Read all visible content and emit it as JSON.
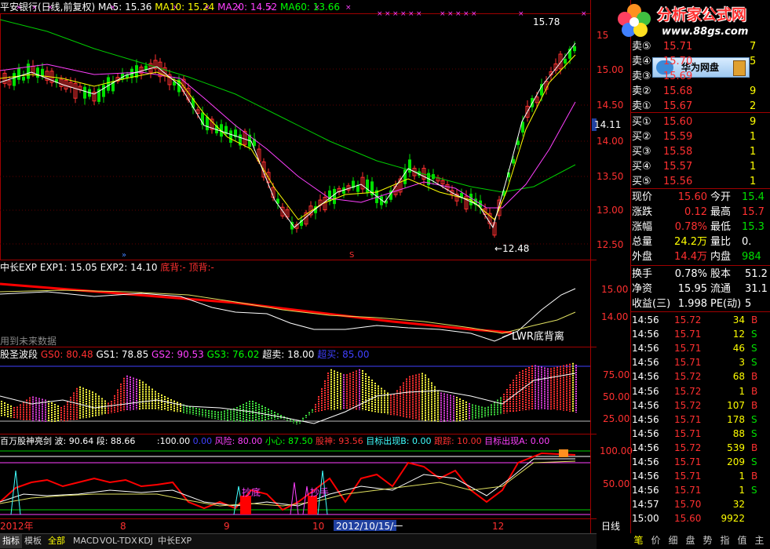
{
  "header": {
    "stock_title": "平安银行(日线,前复权)",
    "ma5": "MA5: 15.36",
    "ma10": "MA10: 15.24",
    "ma20": "MA20: 14.52",
    "ma60": "MA60: 13.66"
  },
  "price_axis": [
    "15.00",
    "14.50",
    "14.00",
    "13.50",
    "13.00",
    "12.50"
  ],
  "price_axis_top": "15",
  "current_price_marker": "14.11",
  "annotations": {
    "high": "15.78",
    "low": "←12.48"
  },
  "exp_panel": {
    "title": "中长EXP",
    "exp1": "EXP1: 15.05",
    "exp2": "EXP2: 14.10",
    "bottom_div": "底背:-",
    "top_div": "顶背:-",
    "note": "用到未来数据",
    "signal": "LWR底背离",
    "axis": [
      "15.00",
      "14.00"
    ]
  },
  "wave_panel": {
    "title": "股圣波段",
    "gs0": "GS0: 80.48",
    "gs1": "GS1: 78.85",
    "gs2": "GS2: 90.53",
    "gs3": "GS3: 76.02",
    "oversell": "超卖: 18.00",
    "overbuy": "超买: 85.00",
    "axis": [
      "75.00",
      "50.00",
      "25.00"
    ]
  },
  "sword_panel": {
    "title": "百万股神亮剑",
    "wave": "波: 90.64",
    "segment": "段: 88.66",
    "v100": ":100.00",
    "v0": "0.00",
    "risk": "风险: 80.00",
    "caution": "小心: 87.50",
    "stock_god": "股神: 93.56",
    "target_b": "目标出现B: 0.00",
    "track": "跟踪: 10.00",
    "target_a": "目标出现A: 0.00",
    "label_bottom": "抄底",
    "label_run": "抄手",
    "axis": [
      "100.00",
      "50.00"
    ]
  },
  "date_axis": [
    "2012年",
    "8",
    "9",
    "10",
    "2012/10/15/一",
    "12"
  ],
  "period_label": "日线",
  "bottom_tabs": [
    "指标",
    "模板",
    "全部",
    "MACD",
    "VOL-TDX",
    "KDJ",
    "中长EXP"
  ],
  "right_tabs": [
    "笔",
    "价",
    "细",
    "盘",
    "势",
    "指",
    "值",
    "主"
  ],
  "logo": {
    "title": "分析家公式网",
    "url": "www.88gs.com"
  },
  "popup": {
    "label": "华为网盘"
  },
  "order_book": {
    "sell": [
      {
        "label": "卖⑤",
        "price": "15.71",
        "vol": "7"
      },
      {
        "label": "卖④",
        "price": "15.70",
        "vol": "5"
      },
      {
        "label": "卖③",
        "price": "15.69",
        "vol": ""
      },
      {
        "label": "卖②",
        "price": "15.68",
        "vol": "9"
      },
      {
        "label": "卖①",
        "price": "15.67",
        "vol": "2"
      }
    ],
    "buy": [
      {
        "label": "买①",
        "price": "15.60",
        "vol": "9"
      },
      {
        "label": "买②",
        "price": "15.59",
        "vol": "1"
      },
      {
        "label": "买③",
        "price": "15.58",
        "vol": "1"
      },
      {
        "label": "买④",
        "price": "15.57",
        "vol": "1"
      },
      {
        "label": "买⑤",
        "price": "15.56",
        "vol": "1"
      }
    ]
  },
  "quote_stats": [
    {
      "l1": "现价",
      "v1": "15.60",
      "c1": "#ff3030",
      "l2": "今开",
      "v2": "15.4",
      "c2": "#00e000"
    },
    {
      "l1": "涨跌",
      "v1": "0.12",
      "c1": "#ff3030",
      "l2": "最高",
      "v2": "15.7",
      "c2": "#ff3030"
    },
    {
      "l1": "涨幅",
      "v1": "0.78%",
      "c1": "#ff3030",
      "l2": "最低",
      "v2": "15.3",
      "c2": "#00e000"
    },
    {
      "l1": "总量",
      "v1": "24.2万",
      "c1": "#ffff00",
      "l2": "量比",
      "v2": "0.",
      "c2": "#ffffff"
    },
    {
      "l1": "外盘",
      "v1": "14.4万",
      "c1": "#ff3030",
      "l2": "内盘",
      "v2": "984",
      "c2": "#00e000"
    }
  ],
  "quote_stats2": [
    {
      "l1": "换手",
      "v1": "0.78%",
      "l2": "股本",
      "v2": "51.2"
    },
    {
      "l1": "净资",
      "v1": "15.95",
      "l2": "流通",
      "v2": "31.1"
    },
    {
      "l1": "收益(三)",
      "v1": "1.998",
      "l2": "PE(动)",
      "v2": "5"
    }
  ],
  "ticks": [
    {
      "time": "14:56",
      "price": "15.72",
      "vol": "34",
      "side": "B"
    },
    {
      "time": "14:56",
      "price": "15.71",
      "vol": "12",
      "side": "S"
    },
    {
      "time": "14:56",
      "price": "15.71",
      "vol": "46",
      "side": "S"
    },
    {
      "time": "14:56",
      "price": "15.71",
      "vol": "3",
      "side": "S"
    },
    {
      "time": "14:56",
      "price": "15.72",
      "vol": "68",
      "side": "B"
    },
    {
      "time": "14:56",
      "price": "15.72",
      "vol": "1",
      "side": "B"
    },
    {
      "time": "14:56",
      "price": "15.72",
      "vol": "107",
      "side": "B"
    },
    {
      "time": "14:56",
      "price": "15.71",
      "vol": "178",
      "side": "S"
    },
    {
      "time": "14:56",
      "price": "15.71",
      "vol": "88",
      "side": "S"
    },
    {
      "time": "14:56",
      "price": "15.72",
      "vol": "539",
      "side": "B"
    },
    {
      "time": "14:56",
      "price": "15.71",
      "vol": "209",
      "side": "S"
    },
    {
      "time": "14:56",
      "price": "15.71",
      "vol": "1",
      "side": "B"
    },
    {
      "time": "14:56",
      "price": "15.71",
      "vol": "1",
      "side": "S"
    },
    {
      "time": "14:57",
      "price": "15.70",
      "vol": "32",
      "side": ""
    },
    {
      "time": "15:00",
      "price": "15.60",
      "vol": "9922",
      "side": ""
    }
  ],
  "colors": {
    "up": "#ff3030",
    "down": "#00e000",
    "ma5": "#ffffff",
    "ma10": "#ffff00",
    "ma20": "#ff40ff",
    "ma60": "#00ff00",
    "grid": "#8b0000"
  }
}
